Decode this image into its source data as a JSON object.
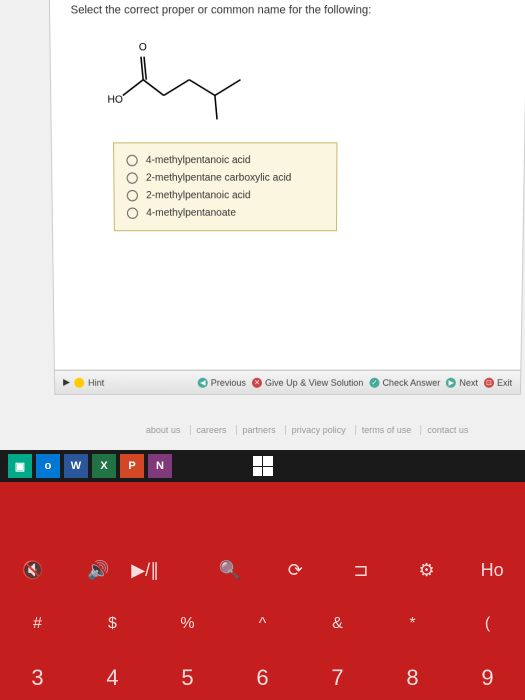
{
  "question": "Select the correct proper or common name for the following:",
  "molecule_labels": {
    "ho": "HO",
    "o": "O"
  },
  "options": [
    "4-methylpentanoic acid",
    "2-methylpentane carboxylic acid",
    "2-methylpentanoic acid",
    "4-methylpentanoate"
  ],
  "nav": {
    "hint": "Hint",
    "previous": "Previous",
    "give_up": "Give Up & View Solution",
    "check": "Check Answer",
    "next": "Next",
    "exit": "Exit"
  },
  "footer": {
    "about": "about us",
    "careers": "careers",
    "partners": "partners",
    "privacy": "privacy policy",
    "terms": "terms of use",
    "contact": "contact us"
  },
  "taskbar": {
    "outlook": "o",
    "word": "W",
    "excel": "X",
    "ppt": "P",
    "onenote": "N"
  },
  "keyboard": {
    "row1": {
      "mute": "🔇",
      "vol": "🔊",
      "play": "▶/∥",
      "search": "🔍",
      "share": "⟳",
      "devices": "⊐",
      "settings": "⚙",
      "home": "Ho"
    },
    "row2": {
      "hash": "#",
      "dollar": "$",
      "percent": "%",
      "caret": "^",
      "amp": "&",
      "star": "*",
      "paren": "("
    },
    "row3": {
      "k3": "3",
      "k4": "4",
      "k5": "5",
      "k6": "6",
      "k7": "7",
      "k8": "8",
      "k9": "9"
    }
  }
}
